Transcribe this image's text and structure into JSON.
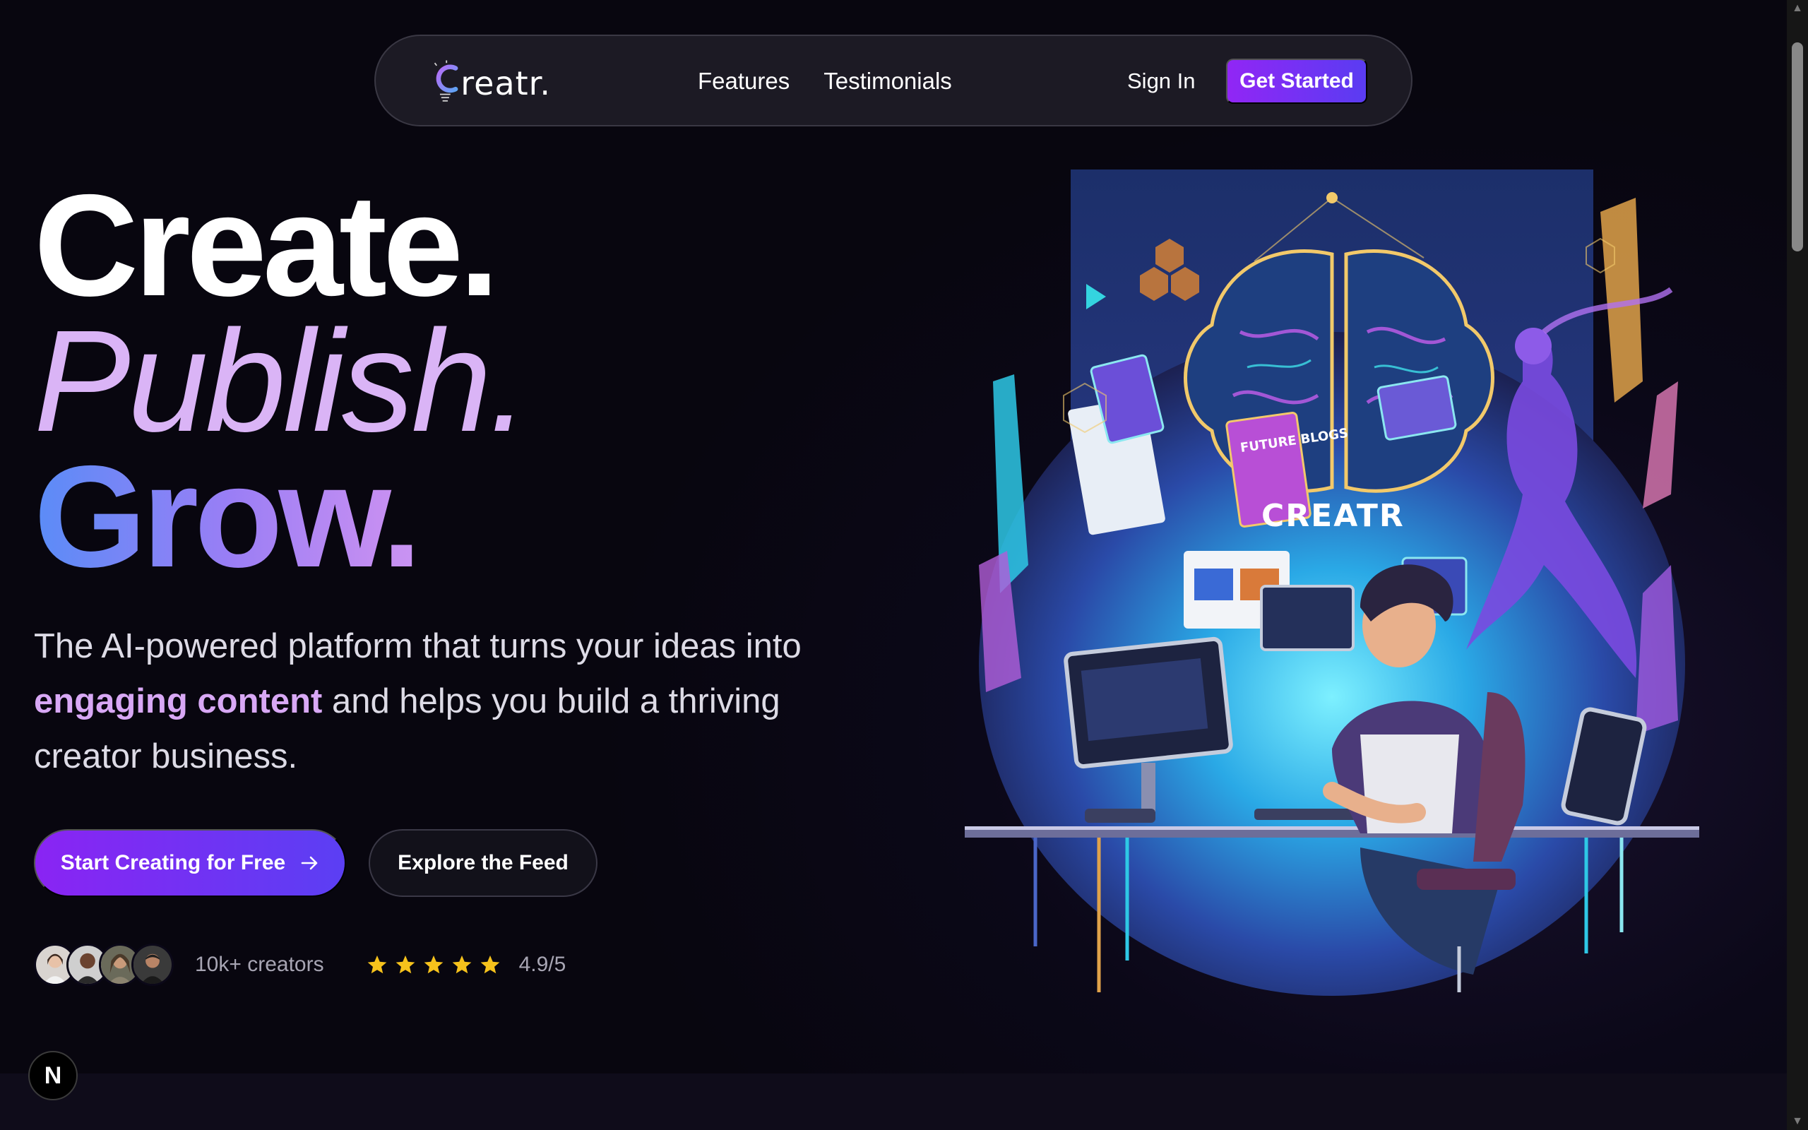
{
  "nav": {
    "logo_text": "reatr.",
    "links": [
      "Features",
      "Testimonials"
    ],
    "sign_in": "Sign In",
    "get_started": "Get Started"
  },
  "hero": {
    "line1": "Create.",
    "line2": "Publish.",
    "line3": "Grow.",
    "subtitle_before": "The AI-powered platform that turns your ideas into ",
    "subtitle_highlight": "engaging content",
    "subtitle_after": " and helps you build a thriving creator business.",
    "cta_primary": "Start Creating for Free",
    "cta_secondary": "Explore the Feed",
    "creators_text": "10k+ creators",
    "rating_text": "4.9/5",
    "stars": 5,
    "illustration_text": [
      "FUTURE BLOGS",
      "CREATR"
    ]
  },
  "next_badge": "N",
  "colors": {
    "accent_purple": "#9126f5",
    "accent_blue": "#5a3cf2",
    "highlight": "#d8a8f5",
    "star": "#f6c21c"
  },
  "icons": [
    "arrow-right-icon",
    "star-icon",
    "lightbulb-icon"
  ]
}
